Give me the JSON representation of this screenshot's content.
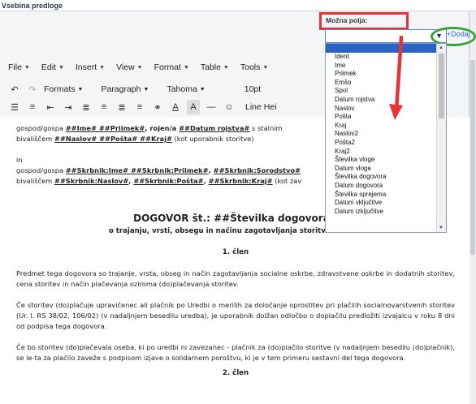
{
  "window": {
    "title": "Vsebina predloge"
  },
  "fields": {
    "label": "Možna polja:",
    "add_label": "+Dodaj",
    "options": [
      "Ident",
      "Ime",
      "Priimek",
      "Emšo",
      "Spol",
      "Datum rojstva",
      "Naslov",
      "Pošta",
      "Kraj",
      "Naslov2",
      "Pošta2",
      "Kraj2",
      "Številka vloge",
      "Datum vloge",
      "Številka dogovora",
      "Datum dogovora",
      "Številka sprejema",
      "Datum vključitve",
      "Datum izključitve"
    ]
  },
  "menubar": [
    "File",
    "Edit",
    "Insert",
    "View",
    "Format",
    "Table",
    "Tools"
  ],
  "toolbar": {
    "formats": "Formats",
    "paragraph": "Paragraph",
    "font": "Tahoma",
    "size": "10pt",
    "line_height": "Line Hei"
  },
  "document": {
    "line1_a": "gospod/gospa ",
    "line1_b": "##Ime# ##Priimek#",
    "line1_c": ", rojen/a ",
    "line1_d": "##Datum rojstva#",
    "line1_e": " s stalnim",
    "line2_a": "bivališčem ",
    "line2_b": "##Naslov# ##Pošta# ##Kraj#",
    "line2_c": " (kot uporabnik storitve)",
    "in": "in",
    "line3_a": "gospod/gospa ",
    "line3_b": "##Skrbnik:Ime# ##Skrbnik:Priimek#",
    "line3_c": ", ",
    "line3_d": "##Skrbnik:Sorodstvo#",
    "line4_a": "bivališčem ",
    "line4_b": "##Skrbnik:Naslov#",
    "line4_c": ", ",
    "line4_d": "##Skrbnik:Pošta#",
    "line4_e": ", ",
    "line4_f": "##Skrbnik:Kraj#",
    "line4_g": " (kot zav",
    "title": "DOGOVOR št.:  ##Številka dogovora#",
    "subtitle": "o trajanju, vrsti, obsegu in načinu zagotavljanja storitve instituc",
    "clen1": "1. člen",
    "para1": "Predmet tega dogovora so trajanje, vrsta, obseg in način zagotavljanja socialne oskrbe, zdravstvene oskrbe in dodatnih storitev, cena storitev in način plačevanja oziroma (do)plačevanja storitev.",
    "para2": "Če storitev (do)plačuje upravičenec ali plačnik po Uredbi o merilih za določanje oprostitev pri plačilih socialnovarstvenih storitev (Ur. l. RS 38/02, 106/02) (v nadaljnjem besedilu uredba), je uporabnik dolžan odločbo o doplačilu predložiti izvajalcu v roku 8 dni od podpisa tega dogovora.",
    "para3": "Če bo storitev (do)plačevala oseba, ki po uredbi ni zavezanec - plačnik za (do)plačilo storitve (v nadaljnjem besedilu (do)plačnik), se le-ta za plačilo zaveže s podpisom izjave o solidarnem poroštvu, ki je v tem primeru sestavni del tega dogovora.",
    "clen2": "2. člen"
  },
  "colors": {
    "highlight_red": "#e4343a",
    "highlight_green": "#3aa23a",
    "selection_blue": "#2a63c6",
    "link_blue": "#2d6fd4"
  }
}
